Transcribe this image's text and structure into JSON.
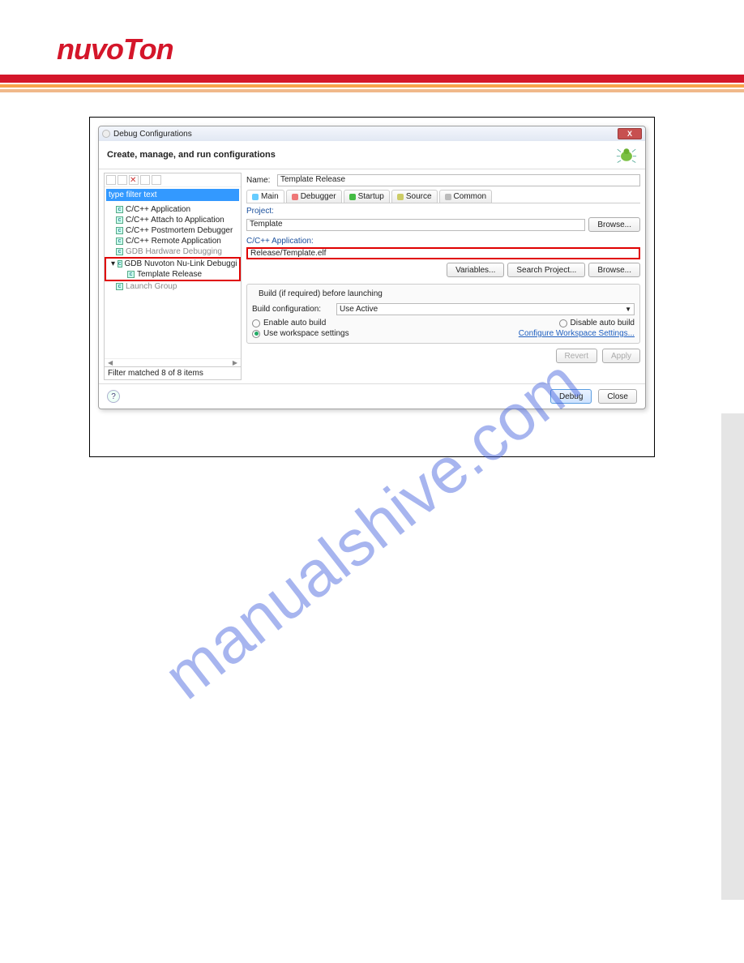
{
  "logo_text": "nuvoTon",
  "watermark": "manualshive.com",
  "dialog": {
    "title": "Debug Configurations",
    "subtitle": "Create, manage, and run configurations",
    "close_x": "X",
    "filter_placeholder": "type filter text",
    "tree_items": [
      {
        "label": "C/C++ Application"
      },
      {
        "label": "C/C++ Attach to Application"
      },
      {
        "label": "C/C++ Postmortem Debugger"
      },
      {
        "label": "C/C++ Remote Application"
      },
      {
        "label": "GDB Hardware Debugging",
        "gray": true
      },
      {
        "label": "GDB Nuvoton Nu-Link Debuggi",
        "expanded": true
      },
      {
        "label": "Template Release",
        "child": true
      },
      {
        "label": "Launch Group",
        "gray": true
      }
    ],
    "filter_status": "Filter matched 8 of 8 items",
    "name_label": "Name:",
    "name_value": "Template Release",
    "tabs": [
      "Main",
      "Debugger",
      "Startup",
      "Source",
      "Common"
    ],
    "project_label": "Project:",
    "project_value": "Template",
    "browse": "Browse...",
    "app_label": "C/C++ Application:",
    "app_value": "Release/Template.elf",
    "variables": "Variables...",
    "search_project": "Search Project...",
    "group_title": "Build (if required) before launching",
    "build_config_label": "Build configuration:",
    "build_config_value": "Use Active",
    "enable_auto": "Enable auto build",
    "disable_auto": "Disable auto build",
    "use_ws": "Use workspace settings",
    "config_ws_link": "Configure Workspace Settings...",
    "revert": "Revert",
    "apply": "Apply",
    "debug": "Debug",
    "close": "Close",
    "help": "?"
  }
}
